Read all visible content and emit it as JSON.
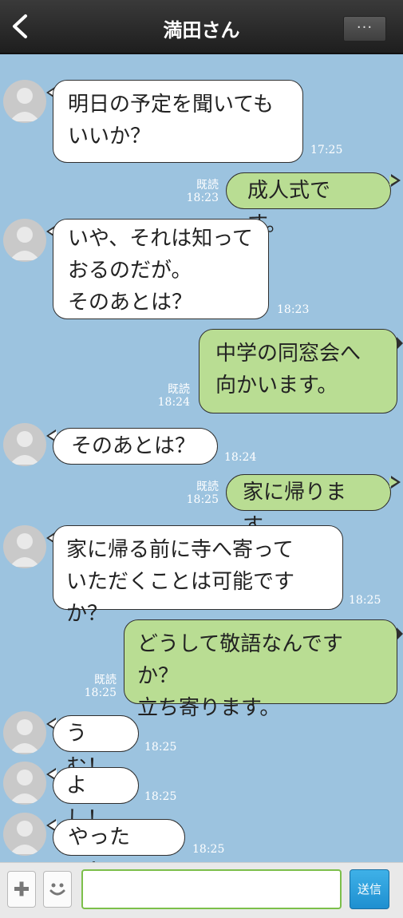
{
  "header": {
    "title": "満田さん",
    "menu_label": "···"
  },
  "messages": [
    {
      "side": "in",
      "text": "明日の予定を聞いても\nいいか？",
      "time": "17:25"
    },
    {
      "side": "out",
      "text": "成人式です。",
      "read": "既読",
      "time": "18:23"
    },
    {
      "side": "in",
      "text": "いや、それは知って\nおるのだが。\nそのあとは？",
      "time": "18:23"
    },
    {
      "side": "out",
      "text": "中学の同窓会へ\n向かいます。",
      "read": "既読",
      "time": "18:24"
    },
    {
      "side": "in",
      "text": "そのあとは？",
      "time": "18:24"
    },
    {
      "side": "out",
      "text": "家に帰ります。",
      "read": "既読",
      "time": "18:25"
    },
    {
      "side": "in",
      "text": "家に帰る前に寺へ寄って\nいただくことは可能ですか？",
      "time": "18:25"
    },
    {
      "side": "out",
      "text": "どうして敬語なんですか？\n立ち寄ります。",
      "read": "既読",
      "time": "18:25"
    },
    {
      "side": "in",
      "text": "うむ！",
      "time": "18:25"
    },
    {
      "side": "in",
      "text": "よし！",
      "time": "18:25"
    },
    {
      "side": "in",
      "text": "やったー！",
      "time": "18:25"
    }
  ],
  "composer": {
    "value": "",
    "send_label": "送信"
  },
  "colors": {
    "background": "#9cc3df",
    "outgoing_bubble": "#b9dd93",
    "incoming_bubble": "#ffffff",
    "send_button": "#2aa0dc"
  }
}
